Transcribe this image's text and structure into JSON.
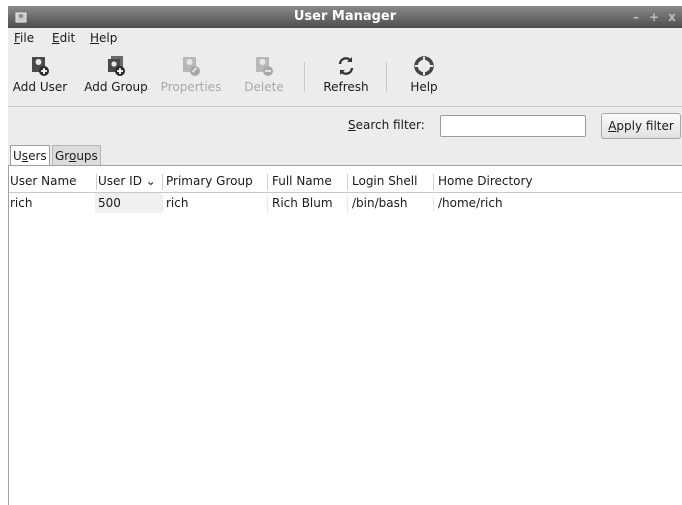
{
  "window": {
    "title": "User Manager",
    "controls": {
      "minimize": "–",
      "maximize": "+",
      "close": "x"
    }
  },
  "menubar": {
    "items": [
      {
        "label": "File",
        "mnemonic": "F",
        "rest": "ile"
      },
      {
        "label": "Edit",
        "mnemonic": "E",
        "rest": "dit"
      },
      {
        "label": "Help",
        "mnemonic": "H",
        "rest": "elp"
      }
    ]
  },
  "toolbar": {
    "add_user": {
      "label": "Add User",
      "icon": "add-user-icon"
    },
    "add_group": {
      "label": "Add Group",
      "icon": "add-group-icon"
    },
    "properties": {
      "label": "Properties",
      "icon": "properties-icon",
      "disabled": true
    },
    "delete": {
      "label": "Delete",
      "icon": "delete-icon",
      "disabled": true
    },
    "refresh": {
      "label": "Refresh",
      "icon": "refresh-icon"
    },
    "help": {
      "label": "Help",
      "icon": "lifebuoy-icon"
    }
  },
  "filter": {
    "label_mnemonic": "S",
    "label_rest": "earch filter:",
    "value": "",
    "apply_mnemonic": "A",
    "apply_rest": "pply filter"
  },
  "tabs": [
    {
      "pre": "U",
      "mnemonic": "s",
      "post": "ers",
      "active": true
    },
    {
      "pre": "Gr",
      "mnemonic": "o",
      "post": "ups",
      "active": false
    }
  ],
  "users_table": {
    "columns": [
      "User Name",
      "User ID",
      "Primary Group",
      "Full Name",
      "Login Shell",
      "Home Directory"
    ],
    "sort_indicator": "⌄",
    "rows": [
      {
        "user_name": "rich",
        "user_id": "500",
        "primary_group": "rich",
        "full_name": "Rich Blum",
        "login_shell": "/bin/bash",
        "home_directory": "/home/rich"
      }
    ]
  },
  "colors": {
    "titlebar_top": "#8a8a8a",
    "titlebar_bottom": "#4d4d4d",
    "window_bg": "#ececec",
    "disabled_text": "#a9a9a9"
  }
}
